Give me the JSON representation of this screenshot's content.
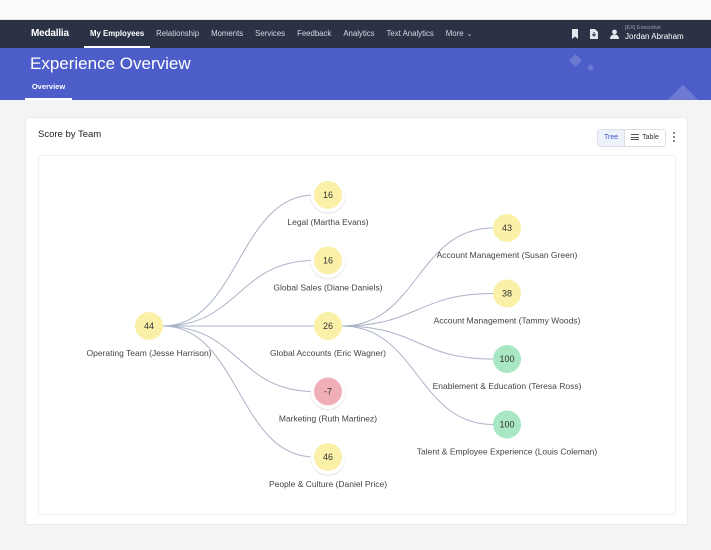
{
  "nav": {
    "logo": "Medallia",
    "items": [
      {
        "label": "My Employees",
        "active": true
      },
      {
        "label": "Relationship",
        "active": false
      },
      {
        "label": "Moments",
        "active": false
      },
      {
        "label": "Services",
        "active": false
      },
      {
        "label": "Feedback",
        "active": false
      },
      {
        "label": "Analytics",
        "active": false
      },
      {
        "label": "Text Analytics",
        "active": false
      },
      {
        "label": "More",
        "active": false,
        "has_dropdown": true
      }
    ],
    "icons": [
      "bookmark-icon",
      "export-icon",
      "user-icon"
    ],
    "user": {
      "role": "[EX] Executive",
      "name": "Jordan Abraham"
    }
  },
  "header": {
    "title": "Experience Overview",
    "tabs": [
      {
        "label": "Overview",
        "active": true
      }
    ]
  },
  "card": {
    "title": "Score by Team",
    "view_toggle": [
      {
        "label": "Tree",
        "active": true
      },
      {
        "label": "Table",
        "active": false,
        "icon": "list-icon"
      }
    ],
    "menu_icon": "more-vertical-icon"
  },
  "colors": {
    "navbar": "#2b3245",
    "hero": "#4d5dc9",
    "score_neutral": "#fbf0a8",
    "score_negative": "#f0aeb6",
    "score_positive": "#a8e6c4",
    "link": "#aab4c8"
  },
  "tree": {
    "root": {
      "id": "op",
      "label": "Operating Team (Jesse Harrison)",
      "score": 44,
      "status": "neutral"
    },
    "level1": [
      {
        "id": "legal",
        "label": "Legal (Martha Evans)",
        "score": 16,
        "status": "neutral",
        "parent": "op",
        "highlight": true
      },
      {
        "id": "sales",
        "label": "Global Sales (Diane Daniels)",
        "score": 16,
        "status": "neutral",
        "parent": "op",
        "highlight": true
      },
      {
        "id": "accts",
        "label": "Global Accounts (Eric Wagner)",
        "score": 26,
        "status": "neutral",
        "parent": "op",
        "highlight": false
      },
      {
        "id": "mkt",
        "label": "Marketing (Ruth Martinez)",
        "score": -7,
        "status": "negative",
        "parent": "op",
        "highlight": true
      },
      {
        "id": "people",
        "label": "People & Culture (Daniel Price)",
        "score": 46,
        "status": "neutral",
        "parent": "op",
        "highlight": true
      }
    ],
    "level2": [
      {
        "id": "am1",
        "label": "Account Management (Susan Green)",
        "score": 43,
        "status": "neutral",
        "parent": "accts"
      },
      {
        "id": "am2",
        "label": "Account Management (Tammy Woods)",
        "score": 38,
        "status": "neutral",
        "parent": "accts"
      },
      {
        "id": "ee",
        "label": "Enablement & Education (Teresa Ross)",
        "score": 100,
        "status": "positive",
        "parent": "accts"
      },
      {
        "id": "tee",
        "label": "Talent & Employee Experience (Louis Coleman)",
        "score": 100,
        "status": "positive",
        "parent": "accts"
      }
    ]
  }
}
